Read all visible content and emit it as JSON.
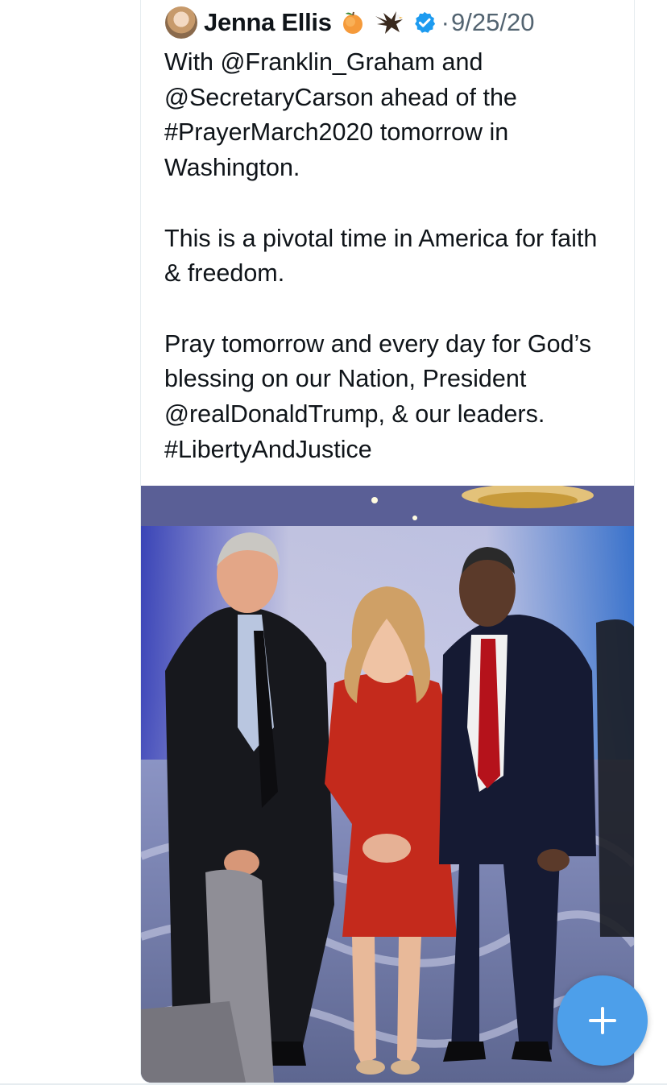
{
  "tweet": {
    "display_name": "Jenna Ellis",
    "separator": "·",
    "timestamp": "9/25/20",
    "name_emojis": [
      "peach-emoji",
      "eagle-emoji"
    ],
    "verified": true,
    "text": "With @Franklin_Graham and @SecretaryCarson ahead of the #PrayerMarch2020 tomorrow in Washington.\n\nThis is a pivotal time in America for faith & freedom.\n\nPray tomorrow and every day for God’s blessing on our Nation, President @realDonaldTrump, & our leaders. #LibertyAndJustice"
  },
  "compose_button": {
    "icon": "plus-icon"
  },
  "colors": {
    "accent": "#1d9bf0",
    "fab": "#4d9fea",
    "text": "#0f1419",
    "muted": "#536471",
    "border": "#e6ecf0"
  }
}
